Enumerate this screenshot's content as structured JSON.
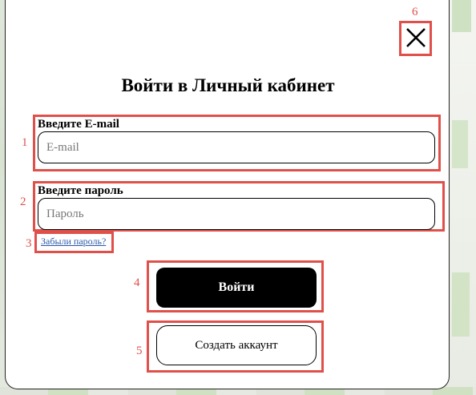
{
  "modal": {
    "title": "Войти в Личный кабинет",
    "close_icon": "close-icon"
  },
  "email": {
    "label": "Введите E-mail",
    "placeholder": "E-mail",
    "value": ""
  },
  "password": {
    "label": "Введите пароль",
    "placeholder": "Пароль",
    "value": ""
  },
  "forgot_link": "Забыли пароль?",
  "buttons": {
    "login": "Войти",
    "create_account": "Создать аккаунт"
  },
  "annotations": {
    "n1": "1",
    "n2": "2",
    "n3": "3",
    "n4": "4",
    "n5": "5",
    "n6": "6"
  },
  "colors": {
    "annotation": "#e0504a",
    "primary_button": "#000000",
    "link": "#2a58a8"
  }
}
